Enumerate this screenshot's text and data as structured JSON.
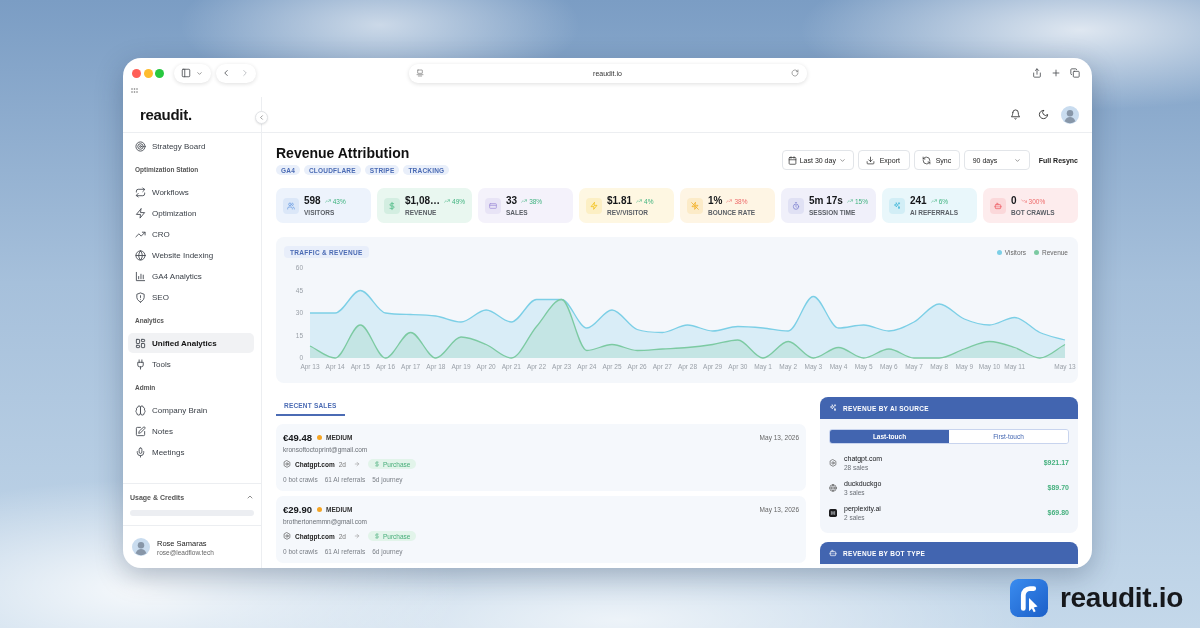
{
  "browser": {
    "address": "reaudit.io"
  },
  "sidebar": {
    "logo": "reaudit.",
    "sections": [
      {
        "items": [
          {
            "label": "Strategy Board",
            "selected": false
          }
        ]
      },
      {
        "title": "Optimization Station",
        "items": [
          {
            "label": "Workflows",
            "selected": false
          },
          {
            "label": "Optimization",
            "selected": false
          },
          {
            "label": "CRO",
            "selected": false
          },
          {
            "label": "Website Indexing",
            "selected": false
          },
          {
            "label": "GA4 Analytics",
            "selected": false
          },
          {
            "label": "SEO",
            "selected": false
          }
        ]
      },
      {
        "title": "Analytics",
        "items": [
          {
            "label": "Unified Analytics",
            "selected": true
          },
          {
            "label": "Tools",
            "selected": false
          }
        ]
      },
      {
        "title": "Admin",
        "items": [
          {
            "label": "Company Brain",
            "selected": false
          },
          {
            "label": "Notes",
            "selected": false
          },
          {
            "label": "Meetings",
            "selected": false
          }
        ]
      }
    ],
    "usage": {
      "title": "Usage & Credits",
      "expanded": true
    },
    "user": {
      "name": "Rose Samaras",
      "email": "rose@leadflow.tech"
    }
  },
  "page": {
    "title": "Revenue Attribution",
    "tags": [
      "GA4",
      "CLOUDFLARE",
      "STRIPE",
      "TRACKING"
    ],
    "date_range": "Last 30 day",
    "export": "Export",
    "sync": "Sync",
    "sync_window": "90 days",
    "full_resync": "Full Resync"
  },
  "stats": [
    {
      "value": "598",
      "change": "43%",
      "rising": true,
      "favorable": true,
      "label": "VISITORS",
      "color": "#dbe7f8"
    },
    {
      "value": "$1,08…",
      "change": "49%",
      "rising": true,
      "favorable": true,
      "label": "REVENUE",
      "color": "#d3eee1"
    },
    {
      "value": "33",
      "change": "38%",
      "rising": true,
      "favorable": true,
      "label": "SALES",
      "color": "#e8e4f6"
    },
    {
      "value": "$1.81",
      "change": "4%",
      "rising": true,
      "favorable": true,
      "label": "REV/VISITOR",
      "color": "#fcefc4"
    },
    {
      "value": "1%",
      "change": "38%",
      "rising": true,
      "favorable": false,
      "label": "BOUNCE RATE",
      "color": "#fcebc8"
    },
    {
      "value": "5m 17s",
      "change": "15%",
      "rising": true,
      "favorable": true,
      "label": "SESSION TIME",
      "color": "#e0e1f4"
    },
    {
      "value": "241",
      "change": "6%",
      "rising": true,
      "favorable": true,
      "label": "AI REFERRALS",
      "color": "#d2eef6"
    },
    {
      "value": "0",
      "change": "300%",
      "rising": false,
      "favorable": false,
      "label": "BOT CRAWLS",
      "color": "#fbd8da"
    }
  ],
  "chart": {
    "title": "TRAFFIC & REVENUE",
    "chart_data": {
      "type": "area",
      "categories": [
        "Apr 13",
        "Apr 14",
        "Apr 15",
        "Apr 16",
        "Apr 17",
        "Apr 18",
        "Apr 19",
        "Apr 20",
        "Apr 21",
        "Apr 22",
        "Apr 23",
        "Apr 24",
        "Apr 25",
        "Apr 26",
        "Apr 27",
        "Apr 28",
        "Apr 29",
        "Apr 30",
        "May 1",
        "May 2",
        "May 3",
        "May 4",
        "May 5",
        "May 6",
        "May 7",
        "May 8",
        "May 9",
        "May 10",
        "May 11",
        null,
        "May 13"
      ],
      "ylim": [
        0,
        60
      ],
      "yticks": [
        0,
        15,
        30,
        45,
        60
      ],
      "series": [
        {
          "name": "Visitors",
          "color": "#7ccfe6",
          "values": [
            30,
            30,
            45,
            30,
            29,
            28,
            24,
            32,
            24,
            39,
            39,
            20,
            32,
            19,
            17,
            22,
            18,
            21,
            20,
            18,
            41,
            20,
            22,
            18,
            24,
            36,
            26,
            22,
            27,
            17,
            12
          ]
        },
        {
          "name": "Revenue",
          "color": "#7ccaa2",
          "values": [
            8,
            0,
            22,
            0,
            17,
            0,
            14,
            9,
            0,
            21,
            39,
            5,
            9,
            5,
            6,
            7,
            9,
            12,
            0,
            11,
            0,
            7,
            0,
            6,
            0,
            0,
            6,
            11,
            7,
            0,
            9
          ]
        }
      ]
    }
  },
  "recent_sales": {
    "tabs": [
      {
        "label": "RECENT SALES",
        "selected": true
      }
    ],
    "sales": [
      {
        "amount": "€49.48",
        "priority": "MEDIUM",
        "color": "#f5a524",
        "date": "May 13, 2026",
        "email": "kronsoftoctoprint@gmail.com",
        "source": "Chatgpt.com",
        "age": "2d",
        "outcome": "Purchase",
        "facts": [
          "0 bot crawls",
          "61 AI referrals",
          "5d journey"
        ]
      },
      {
        "amount": "€29.90",
        "priority": "MEDIUM",
        "color": "#f5a524",
        "date": "May 13, 2026",
        "email": "brothertonemmn@gmail.com",
        "source": "Chatgpt.com",
        "age": "2d",
        "outcome": "Purchase",
        "facts": [
          "0 bot crawls",
          "61 AI referrals",
          "6d journey"
        ]
      }
    ]
  },
  "ai_source": {
    "title": "REVENUE BY AI SOURCE",
    "modes": [
      {
        "label": "Last-touch",
        "selected": true
      },
      {
        "label": "First-touch",
        "selected": false
      }
    ],
    "rows": [
      {
        "name": "chatgpt.com",
        "count": "28 sales",
        "revenue": "$921.17"
      },
      {
        "name": "duckduckgo",
        "count": "3 sales",
        "revenue": "$89.70"
      },
      {
        "name": "perplexity.ai",
        "count": "2 sales",
        "revenue": "$69.80"
      }
    ]
  },
  "bot_type": {
    "title": "REVENUE BY BOT TYPE"
  },
  "brand": {
    "name": "reaudit.io"
  }
}
